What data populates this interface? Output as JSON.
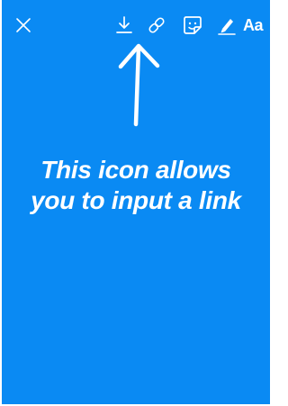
{
  "caption": {
    "line1": "This icon allows",
    "line2": "you to input a link"
  },
  "toolbar": {
    "text_tool_label": "Aa",
    "icons": [
      "close-icon",
      "download-icon",
      "link-icon",
      "sticker-icon",
      "draw-icon"
    ]
  },
  "colors": {
    "background": "#0a8af3",
    "foreground": "#ffffff"
  }
}
